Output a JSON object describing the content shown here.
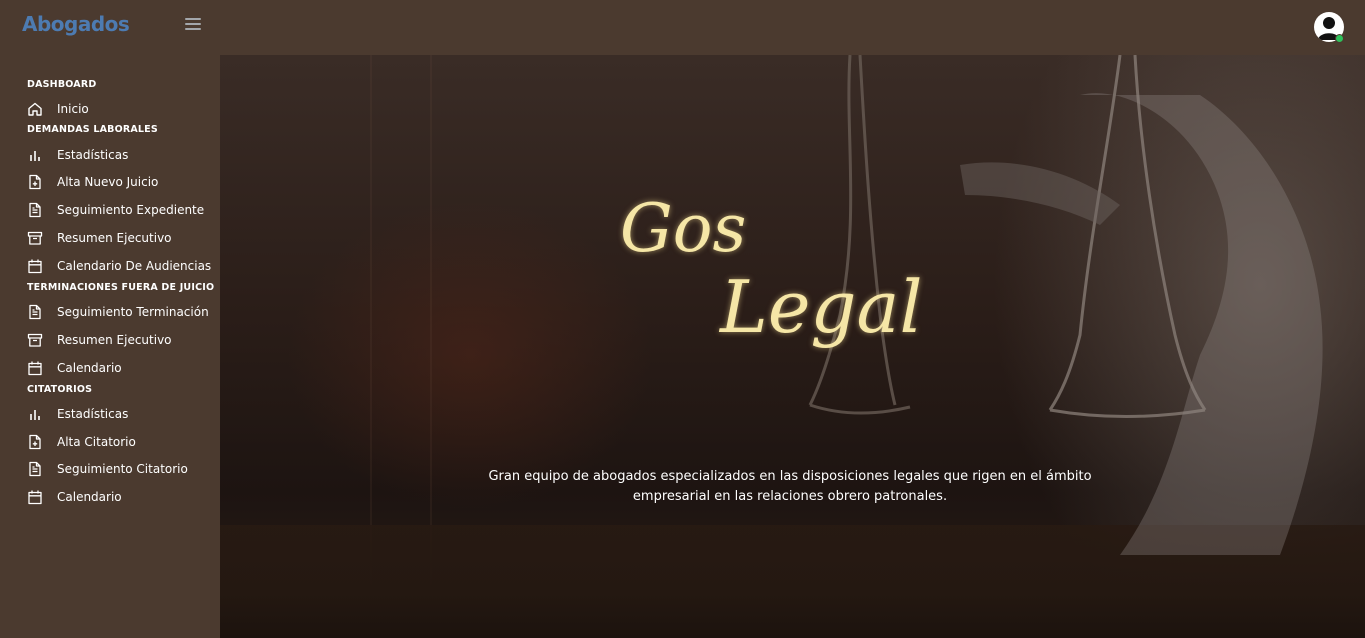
{
  "app": {
    "brand": "Abogados"
  },
  "sidebar": {
    "sections": [
      {
        "title": "DASHBOARD",
        "items": [
          {
            "label": "Inicio",
            "icon": "home-icon"
          }
        ]
      },
      {
        "title": "DEMANDAS LABORALES",
        "items": [
          {
            "label": "Estadísticas",
            "icon": "bar-chart-icon"
          },
          {
            "label": "Alta Nuevo Juicio",
            "icon": "file-plus-icon"
          },
          {
            "label": "Seguimiento Expediente",
            "icon": "file-text-icon"
          },
          {
            "label": "Resumen Ejecutivo",
            "icon": "archive-icon"
          },
          {
            "label": "Calendario De Audiencias",
            "icon": "calendar-icon"
          }
        ]
      },
      {
        "title": "TERMINACIONES FUERA DE JUICIO",
        "items": [
          {
            "label": "Seguimiento Terminación",
            "icon": "file-text-icon"
          },
          {
            "label": "Resumen Ejecutivo",
            "icon": "archive-icon"
          },
          {
            "label": "Calendario",
            "icon": "calendar-icon"
          }
        ]
      },
      {
        "title": "CITATORIOS",
        "items": [
          {
            "label": "Estadísticas",
            "icon": "bar-chart-icon"
          },
          {
            "label": "Alta Citatorio",
            "icon": "file-plus-icon"
          },
          {
            "label": "Seguimiento Citatorio",
            "icon": "file-text-icon"
          },
          {
            "label": "Calendario",
            "icon": "calendar-icon"
          }
        ]
      }
    ]
  },
  "hero": {
    "logo_line1": "Gos",
    "logo_line2": "Legal",
    "tagline": "Gran equipo de abogados especializados en las disposiciones legales que rigen en el ámbito empresarial en las relaciones obrero patronales."
  },
  "colors": {
    "brand": "#4d7bb1",
    "sidebar_bg": "#4b3a2f",
    "logo_gold": "#f5e6a6",
    "online": "#2ec15b"
  }
}
